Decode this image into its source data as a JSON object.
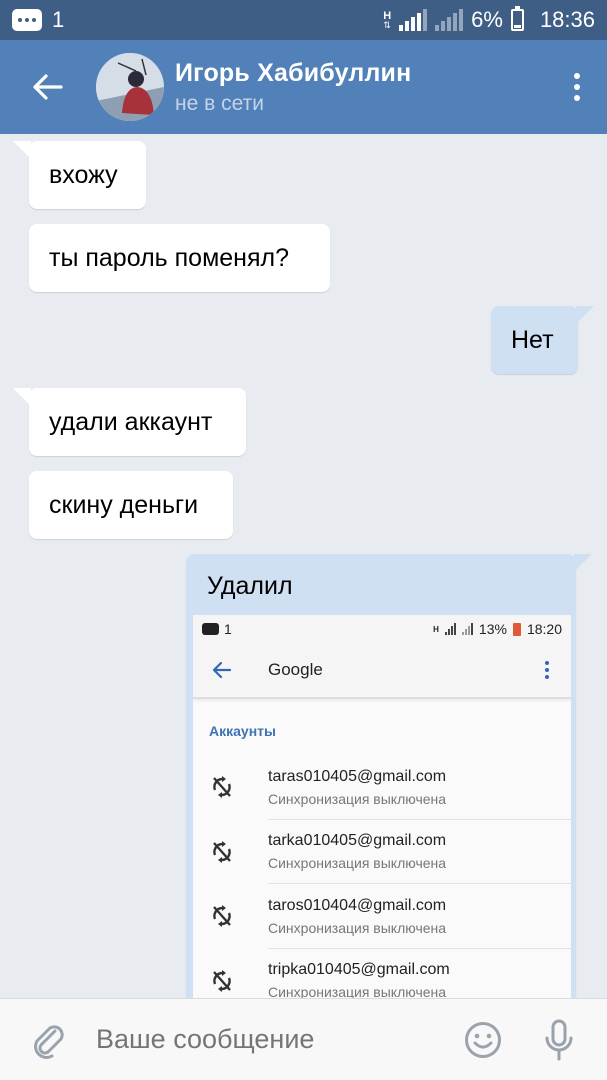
{
  "status_bar": {
    "notification_count": "1",
    "network_label": "H",
    "battery": "6%",
    "time": "18:36"
  },
  "header": {
    "contact_name": "Игорь Хабибуллин",
    "contact_status": "не в сети"
  },
  "messages": [
    {
      "direction": "in",
      "text": "вхожу"
    },
    {
      "direction": "in",
      "text": "ты пароль поменял?"
    },
    {
      "direction": "out",
      "text": "Нет"
    },
    {
      "direction": "in",
      "text": "удали аккаунт"
    },
    {
      "direction": "in",
      "text": "скину деньги"
    },
    {
      "direction": "out",
      "text": "Удалил"
    }
  ],
  "attached_screenshot": {
    "status": {
      "notification_count": "1",
      "network_label": "H",
      "battery": "13%",
      "time": "18:20"
    },
    "title": "Google",
    "section": "Аккаунты",
    "accounts": [
      {
        "email": "taras010405@gmail.com",
        "status": "Синхронизация выключена"
      },
      {
        "email": "tarka010405@gmail.com",
        "status": "Синхронизация выключена"
      },
      {
        "email": "taros010404@gmail.com",
        "status": "Синхронизация выключена"
      },
      {
        "email": "tripka010405@gmail.com",
        "status": "Синхронизация выключена"
      }
    ]
  },
  "input": {
    "placeholder": "Ваше сообщение"
  },
  "colors": {
    "header": "#5181b8",
    "status_bar": "#3f5e86",
    "outgoing_bubble": "#cfe0f3",
    "incoming_bubble": "#ffffff",
    "chat_background": "#e8ecf1"
  }
}
